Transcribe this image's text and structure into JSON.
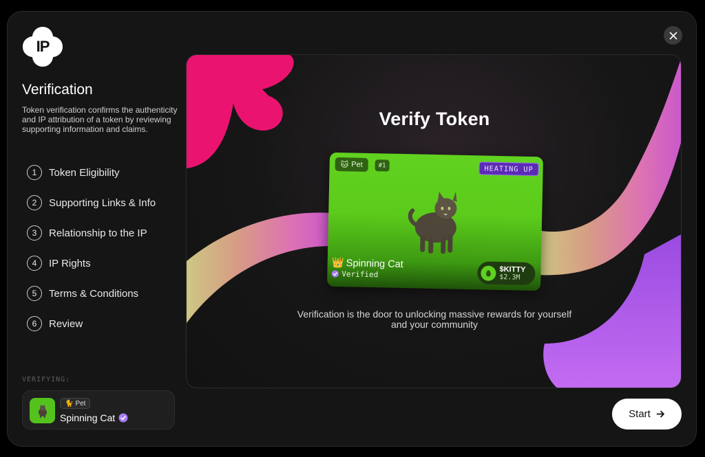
{
  "logo": {
    "text": "IP"
  },
  "sidebar": {
    "title": "Verification",
    "description": "Token verification confirms the authenticity and IP attribution of a token by reviewing supporting information and claims.",
    "steps": [
      {
        "num": "1",
        "label": "Token Eligibility"
      },
      {
        "num": "2",
        "label": "Supporting Links & Info"
      },
      {
        "num": "3",
        "label": "Relationship to the IP"
      },
      {
        "num": "4",
        "label": "IP Rights"
      },
      {
        "num": "5",
        "label": "Terms & Conditions"
      },
      {
        "num": "6",
        "label": "Review"
      }
    ],
    "verifying_label": "VERIFYING:",
    "verifying_card": {
      "chip": "Pet",
      "name": "Spinning Cat"
    }
  },
  "hero": {
    "title": "Verify Token",
    "subtitle": "Verification is the door to unlocking massive rewards for yourself and your community",
    "token_card": {
      "category": "Pet",
      "number": "#1",
      "status": "HEATING UP",
      "name": "Spinning Cat",
      "verified": "Verified",
      "ticker": "$KITTY",
      "market_cap": "$2.3M"
    }
  },
  "actions": {
    "start": "Start"
  },
  "colors": {
    "accent_green": "#5ccb1b",
    "accent_purple": "#8b5cf6",
    "pink": "#e8146c"
  },
  "icons": [
    "ip-logo-icon",
    "close-icon",
    "arrow-right-icon",
    "verified-badge-icon",
    "cat-icon",
    "crown-icon"
  ]
}
